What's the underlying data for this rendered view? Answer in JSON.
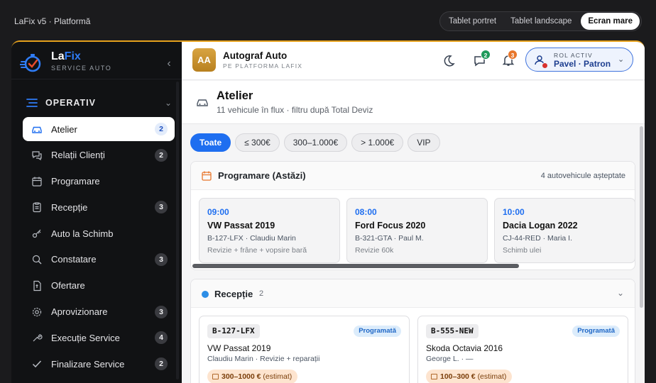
{
  "app_title": "LaFix v5 · Platformă",
  "modes": [
    "Tablet portret",
    "Tablet landscape",
    "Ecran mare"
  ],
  "brand": {
    "name_a": "La",
    "name_b": "Fix",
    "sub": "SERVICE AUTO"
  },
  "sidebar": {
    "section": "OPERATIV",
    "items": [
      {
        "label": "Atelier",
        "badge": "2",
        "icon": "car-icon"
      },
      {
        "label": "Relații Clienți",
        "badge": "2",
        "icon": "chat-icon"
      },
      {
        "label": "Programare",
        "badge": "",
        "icon": "calendar-icon"
      },
      {
        "label": "Recepție",
        "badge": "3",
        "icon": "clipboard-icon"
      },
      {
        "label": "Auto la Schimb",
        "badge": "",
        "icon": "key-icon"
      },
      {
        "label": "Constatare",
        "badge": "3",
        "icon": "magnifier-icon"
      },
      {
        "label": "Ofertare",
        "badge": "",
        "icon": "document-icon"
      },
      {
        "label": "Aprovizionare",
        "badge": "3",
        "icon": "gear-icon"
      },
      {
        "label": "Execuție Service",
        "badge": "4",
        "icon": "wrench-icon"
      },
      {
        "label": "Finalizare Service",
        "badge": "2",
        "icon": "check-icon"
      }
    ]
  },
  "header": {
    "org_initials": "AA",
    "org_name": "Autograf Auto",
    "org_sub": "PE PLATFORMA LAFIX",
    "messages_count": "2",
    "alerts_count": "3",
    "role_label": "ROL ACTIV",
    "role_name": "Pavel · Patron"
  },
  "page": {
    "title": "Atelier",
    "subtitle": "11 vehicule în flux · filtru după Total Deviz"
  },
  "filters": [
    "Toate",
    "≤ 300€",
    "300–1.000€",
    "> 1.000€",
    "VIP"
  ],
  "programare": {
    "title": "Programare (Astăzi)",
    "right": "4 autovehicule așteptate",
    "items": [
      {
        "time": "09:00",
        "car": "VW Passat 2019",
        "meta": "B-127-LFX · Claudiu Marin",
        "task": "Revizie + frâne + vopsire bară"
      },
      {
        "time": "08:00",
        "car": "Ford Focus 2020",
        "meta": "B-321-GTA · Paul M.",
        "task": "Revizie 60k"
      },
      {
        "time": "10:00",
        "car": "Dacia Logan 2022",
        "meta": "CJ-44-RED · Maria I.",
        "task": "Schimb ulei"
      }
    ]
  },
  "receptie": {
    "title": "Recepție",
    "count": "2",
    "jobs": [
      {
        "plate": "B-127-LFX",
        "status": "Programată",
        "car": "VW Passat 2019",
        "meta": "Claudiu Marin · Revizie + reparații",
        "estimate": "300–1000 €",
        "estimate_note": "(estimat)"
      },
      {
        "plate": "B-555-NEW",
        "status": "Programată",
        "car": "Skoda Octavia 2016",
        "meta": "George L. · —",
        "estimate": "100–300 €",
        "estimate_note": "(estimat)"
      }
    ]
  },
  "colors": {
    "accent": "#1e6ef0",
    "brand_gold": "#d9a441",
    "sidebar_bg": "#111214"
  }
}
